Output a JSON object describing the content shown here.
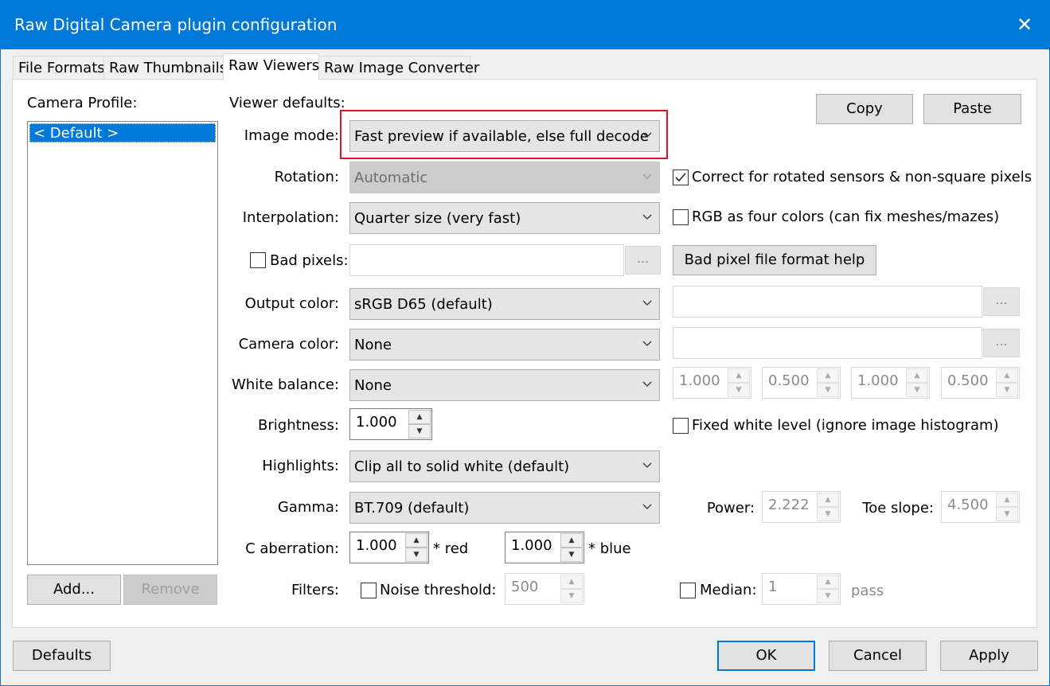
{
  "window": {
    "title": "Raw Digital Camera plugin configuration",
    "close_label": "✕"
  },
  "tabs": [
    "File Formats",
    "Raw Thumbnails",
    "Raw Viewers",
    "Raw Image Converter"
  ],
  "sidebar": {
    "camera_profile_label": "Camera Profile:",
    "items": [
      "< Default >"
    ],
    "add_label": "Add...",
    "remove_label": "Remove"
  },
  "viewer": {
    "heading": "Viewer defaults:",
    "copy_label": "Copy",
    "paste_label": "Paste",
    "image_mode": {
      "label": "Image mode:",
      "value": "Fast preview if available, else full decode"
    },
    "rotation": {
      "label": "Rotation:",
      "value": "Automatic"
    },
    "correct_rotated": {
      "label": "Correct for rotated sensors & non-square pixels",
      "checked": true
    },
    "interpolation": {
      "label": "Interpolation:",
      "value": "Quarter size (very fast)"
    },
    "rgb_four": {
      "label": "RGB as four colors (can fix meshes/mazes)",
      "checked": false
    },
    "bad_pixels": {
      "label": "Bad pixels:",
      "checked": false,
      "value": "",
      "browse": "...",
      "help_label": "Bad pixel file format help"
    },
    "output_color": {
      "label": "Output color:",
      "value": "sRGB D65 (default)",
      "path": "",
      "browse": "..."
    },
    "camera_color": {
      "label": "Camera color:",
      "value": "None",
      "path": "",
      "browse": "..."
    },
    "white_balance": {
      "label": "White balance:",
      "value": "None",
      "multipliers": [
        "1.000",
        "0.500",
        "1.000",
        "0.500"
      ]
    },
    "brightness": {
      "label": "Brightness:",
      "value": "1.000"
    },
    "fixed_white": {
      "label": "Fixed white level (ignore image histogram)",
      "checked": false
    },
    "highlights": {
      "label": "Highlights:",
      "value": "Clip all to solid white (default)"
    },
    "gamma": {
      "label": "Gamma:",
      "value": "BT.709 (default)",
      "power_label": "Power:",
      "power": "2.222",
      "toe_label": "Toe slope:",
      "toe": "4.500"
    },
    "c_aberration": {
      "label": "C aberration:",
      "red": "1.000",
      "red_label": "* red",
      "blue": "1.000",
      "blue_label": "* blue"
    },
    "filters": {
      "label": "Filters:",
      "noise_label": "Noise threshold:",
      "noise_checked": false,
      "noise_value": "500",
      "median_label": "Median:",
      "median_checked": false,
      "median_value": "1",
      "pass_label": "pass"
    }
  },
  "footer": {
    "defaults_label": "Defaults",
    "ok_label": "OK",
    "cancel_label": "Cancel",
    "apply_label": "Apply"
  },
  "colors": {
    "titlebar": "#0078d7",
    "selection": "#0078d7",
    "highlight_box": "#e81123"
  }
}
